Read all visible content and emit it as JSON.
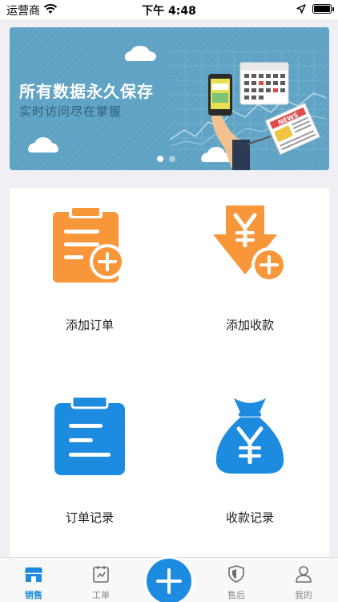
{
  "status_bar": {
    "carrier": "运营商",
    "time": "下午 4:48",
    "icons": [
      "wifi-icon",
      "location-arrow-icon",
      "battery-icon"
    ]
  },
  "banner": {
    "title": "所有数据永久保存",
    "subtitle": "实时访问尽在掌握",
    "newspaper_text": "NEWS",
    "slide_count": 2,
    "active_slide": 1
  },
  "actions": [
    {
      "label": "添加订单",
      "icon": "add-order-icon",
      "color": "#f8963a"
    },
    {
      "label": "添加收款",
      "icon": "add-payment-icon",
      "color": "#f8963a"
    },
    {
      "label": "订单记录",
      "icon": "order-records-icon",
      "color": "#1c8be0"
    },
    {
      "label": "收款记录",
      "icon": "payment-records-icon",
      "color": "#1c8be0"
    }
  ],
  "tabbar": {
    "items": [
      {
        "label": "销售",
        "icon": "store-icon",
        "active": true
      },
      {
        "label": "工单",
        "icon": "work-order-icon",
        "active": false
      },
      {
        "label": "",
        "icon": "plus-icon",
        "active": false
      },
      {
        "label": "售后",
        "icon": "shield-icon",
        "active": false
      },
      {
        "label": "我的",
        "icon": "user-icon",
        "active": false
      }
    ]
  },
  "colors": {
    "accent_blue": "#1c8be0",
    "accent_orange": "#f8963a",
    "banner_bg": "#5fa2c4"
  }
}
